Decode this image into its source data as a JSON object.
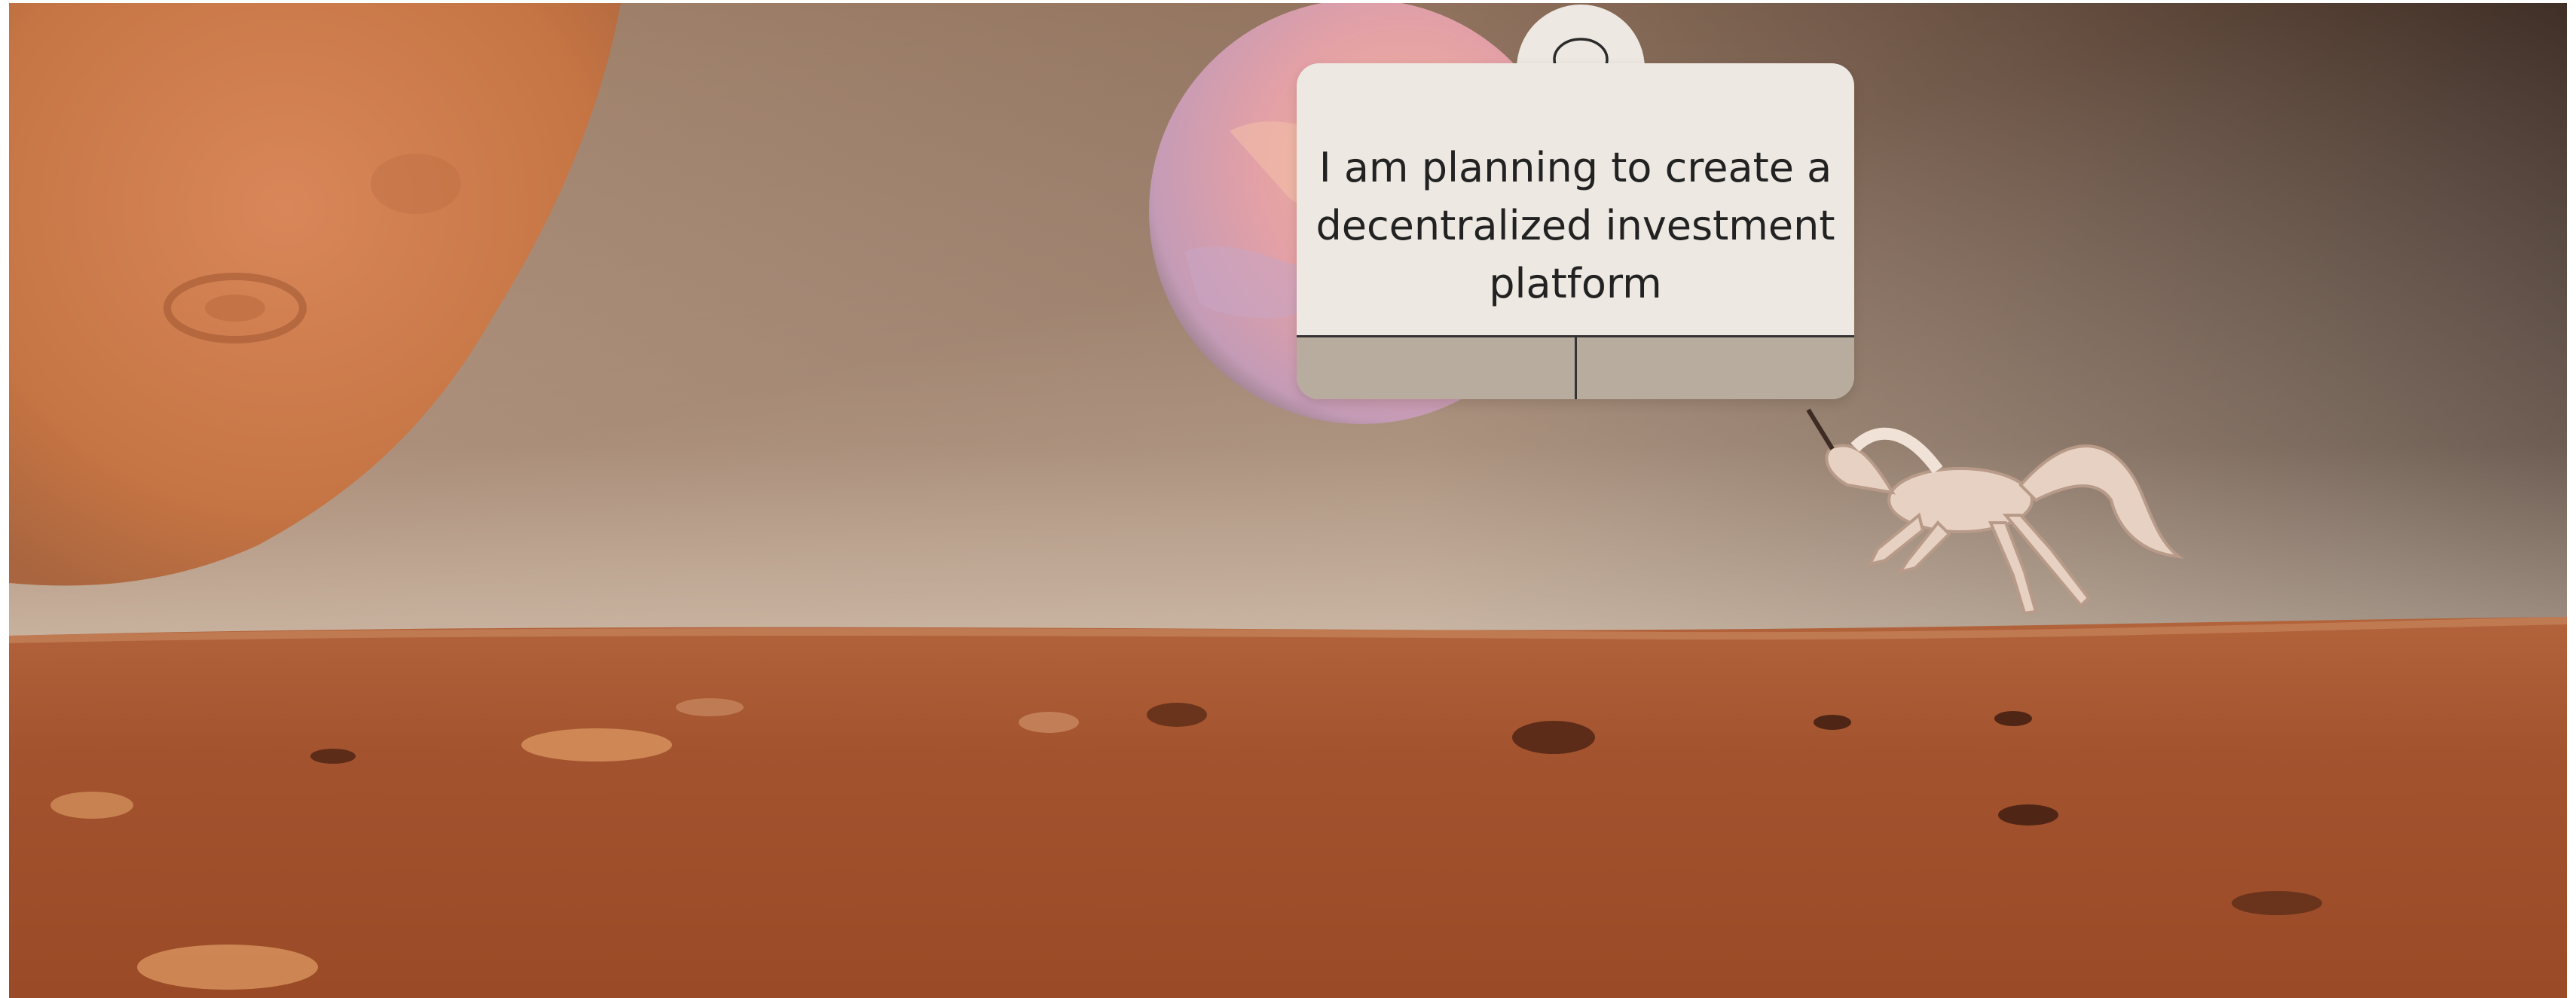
{
  "speech": {
    "text": "I am planning to create a decentralized investment platform",
    "icon": "speech-bubble-icon"
  },
  "scene": {
    "colors": {
      "sky_top": "#3b2a22",
      "sky_mid": "#8d6a55",
      "sky_horizon": "#c9b29e",
      "ground": "#a4532e",
      "planet_left": "#c8743f",
      "moon": "#e9a98f",
      "unicorn": "#e6d1c2"
    }
  }
}
